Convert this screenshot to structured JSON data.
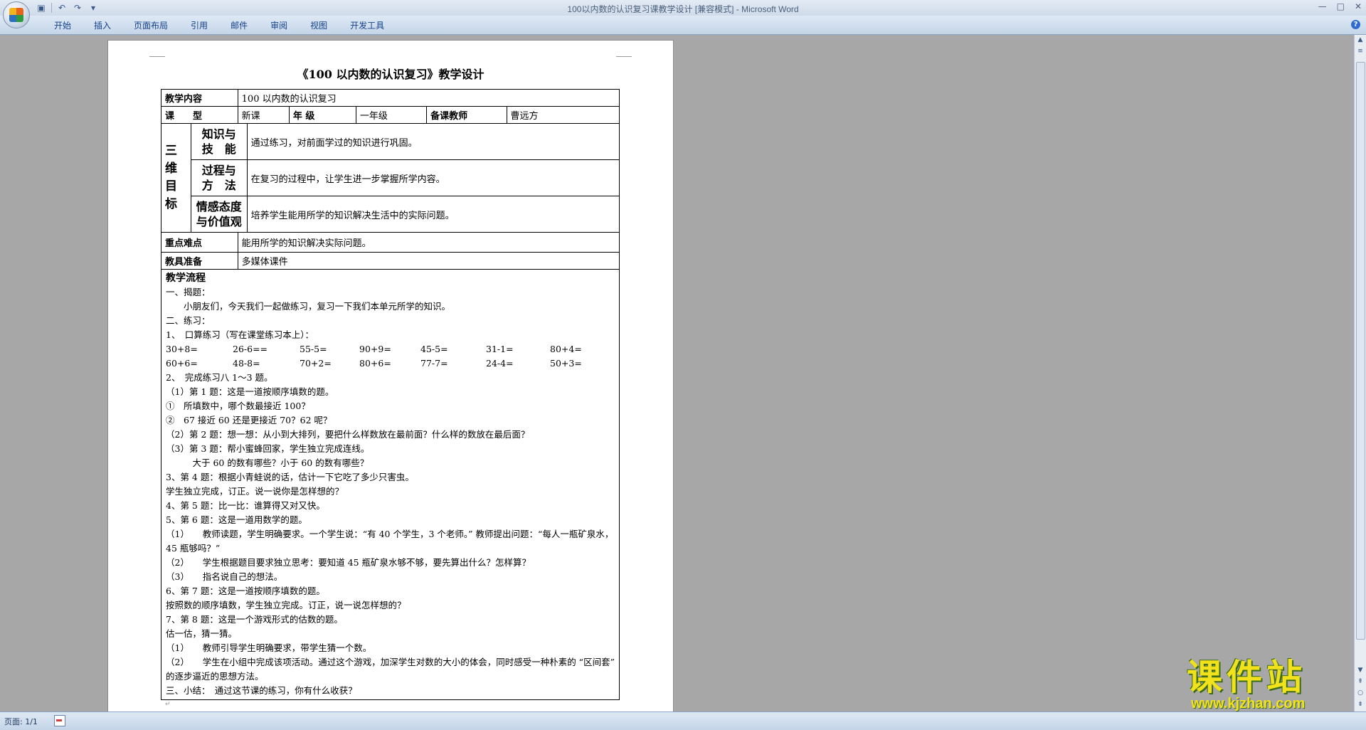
{
  "window": {
    "title": "100以内数的认识复习课教学设计 [兼容模式] - Microsoft Word",
    "controls": [
      "—",
      "□",
      "✕"
    ]
  },
  "qat": {
    "save_icon": "save-icon",
    "undo_icon": "undo-icon",
    "redo_icon": "redo-icon",
    "customize_icon": "customize-icon"
  },
  "ribbon": {
    "tabs": [
      "开始",
      "插入",
      "页面布局",
      "引用",
      "邮件",
      "审阅",
      "视图",
      "开发工具"
    ],
    "help": "?"
  },
  "document": {
    "title": "《100 以内数的认识复习》教学设计",
    "content_label": "教学内容",
    "content_value": "100 以内数的认识复习",
    "type_label": "课　　型",
    "type_value": "新课",
    "grade_label": "年 级",
    "grade_value": "一年级",
    "teacher_label": "备课教师",
    "teacher_value": "曹远方",
    "goals_label": [
      "三",
      "维",
      "目",
      "标"
    ],
    "goals": [
      {
        "label1": "知识与",
        "label2": "技　能",
        "text": "通过练习，对前面学过的知识进行巩固。"
      },
      {
        "label1": "过程与",
        "label2": "方　法",
        "text": "在复习的过程中，让学生进一步掌握所学内容。"
      },
      {
        "label1": "情感态度",
        "label2": "与价值观",
        "text": "培养学生能用所学的知识解决生活中的实际问题。"
      }
    ],
    "keypoints_label": "重点难点",
    "keypoints_value": "能用所学的知识解决实际问题。",
    "tools_label": "教具准备",
    "tools_value": "多媒体课件",
    "flow_label": "教学流程",
    "flow_lines_a": [
      "一、揭题：",
      "　　小朋友们，今天我们一起做练习，复习一下我们本单元所学的知识。",
      "二、练习：",
      "1、　口算练习（写在课堂练习本上）："
    ],
    "calc_row1": [
      "30+8=",
      "26-6==",
      "55-5=",
      "90+9=",
      "45-5=",
      "31-1=",
      "80+4="
    ],
    "calc_row2": [
      "60+6=",
      "48-8=",
      "70+2=",
      "80+6=",
      "77-7=",
      "24-4=",
      "50+3="
    ],
    "flow_lines_b": [
      "2、　完成练习八 1～3 题。",
      "（1）第 1 题：这是一道按顺序填数的题。",
      "①　所填数中，哪个数最接近 100？",
      "②　67 接近 60 还是更接近 70？62 呢？",
      "（2）第 2 题：想一想：从小到大排列，要把什么样数放在最前面？什么样的数放在最后面？",
      "（3）第 3 题：帮小蜜蜂回家，学生独立完成连线。",
      "　　　大于 60 的数有哪些？小于 60 的数有哪些？",
      "3、第 4 题：根据小青蛙说的话，估计一下它吃了多少只害虫。",
      "学生独立完成，订正。说一说你是怎样想的？",
      "4、第 5 题：比一比：谁算得又对又快。",
      "5、第 6 题：这是一道用数学的题。"
    ],
    "flow_para1": "（1）　　教师读题，学生明确要求。一个学生说：“有 40 个学生，3 个老师。” 教师提出问题：“每人一瓶矿泉水，45 瓶够吗？”",
    "flow_lines_c": [
      "（2）　　学生根据题目要求独立思考：要知道 45 瓶矿泉水够不够，要先算出什么？怎样算？",
      "（3）　　指名说自己的想法。",
      "6、第 7 题：这是一道按顺序填数的题。",
      "按照数的顺序填数，学生独立完成。订正，说一说怎样想的？",
      "7、第 8 题：这是一个游戏形式的估数的题。",
      "估一估，猜一猜。",
      "（1）　　教师引导学生明确要求，带学生猜一个数。"
    ],
    "flow_para2": "（2）　　学生在小组中完成该项活动。通过这个游戏，加深学生对数的大小的体会，同时感受一种朴素的 “区间套” 的逐步逼近的思想方法。",
    "flow_last": "三、小结：　通过这节课的练习，你有什么收获？"
  },
  "statusbar": {
    "page": "页面: 1/1"
  },
  "watermark": {
    "text": "课件站",
    "url": "www.kjzhan.com"
  }
}
